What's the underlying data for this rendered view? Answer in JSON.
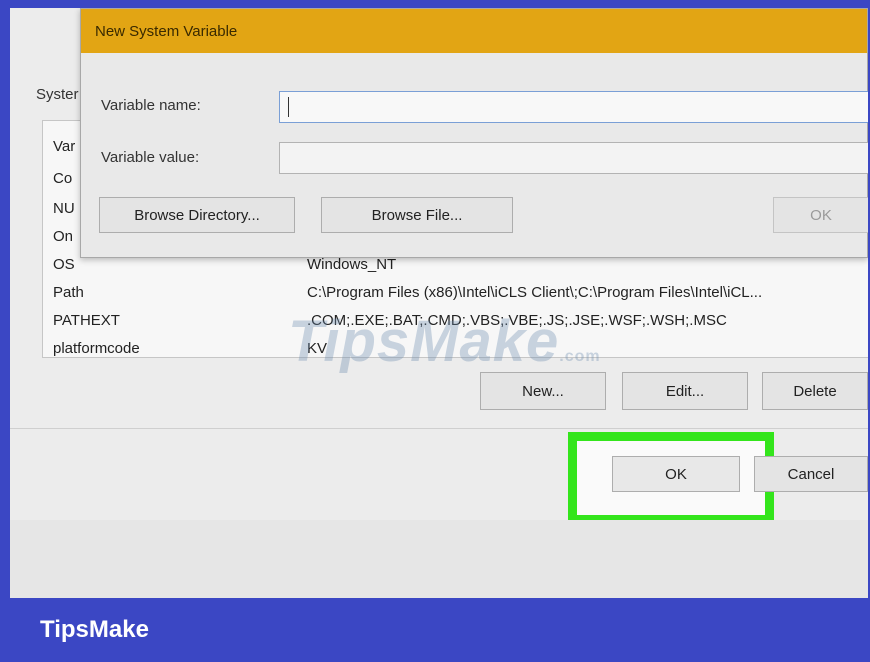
{
  "env_dialog": {
    "group_label": "Syster",
    "rows": [
      {
        "name": "Var",
        "value": ""
      },
      {
        "name": "Co",
        "value": ""
      },
      {
        "name": "NU",
        "value": ""
      },
      {
        "name": "On",
        "value": ""
      },
      {
        "name": "OS",
        "value": "Windows_NT"
      },
      {
        "name": "Path",
        "value": "C:\\Program Files (x86)\\Intel\\iCLS Client\\;C:\\Program Files\\Intel\\iCL..."
      },
      {
        "name": "PATHEXT",
        "value": ".COM;.EXE;.BAT;.CMD;.VBS;.VBE;.JS;.JSE;.WSF;.WSH;.MSC"
      },
      {
        "name": "platformcode",
        "value": "KV"
      }
    ],
    "new_label": "New...",
    "edit_label": "Edit...",
    "delete_label": "Delete",
    "ok_label": "OK",
    "cancel_label": "Cancel"
  },
  "new_var_dialog": {
    "title": "New System Variable",
    "name_label": "Variable name:",
    "value_label": "Variable value:",
    "name_value": "",
    "value_value": "",
    "browse_dir_label": "Browse Directory...",
    "browse_file_label": "Browse File...",
    "ok_label": "OK"
  },
  "watermark": {
    "text": "TipsMake",
    "suffix": ".com"
  },
  "brand": {
    "label": "TipsMake"
  },
  "colors": {
    "highlight": "#33e51b",
    "title_bar": "#e2a514",
    "brand_bar": "#3b47c4"
  }
}
